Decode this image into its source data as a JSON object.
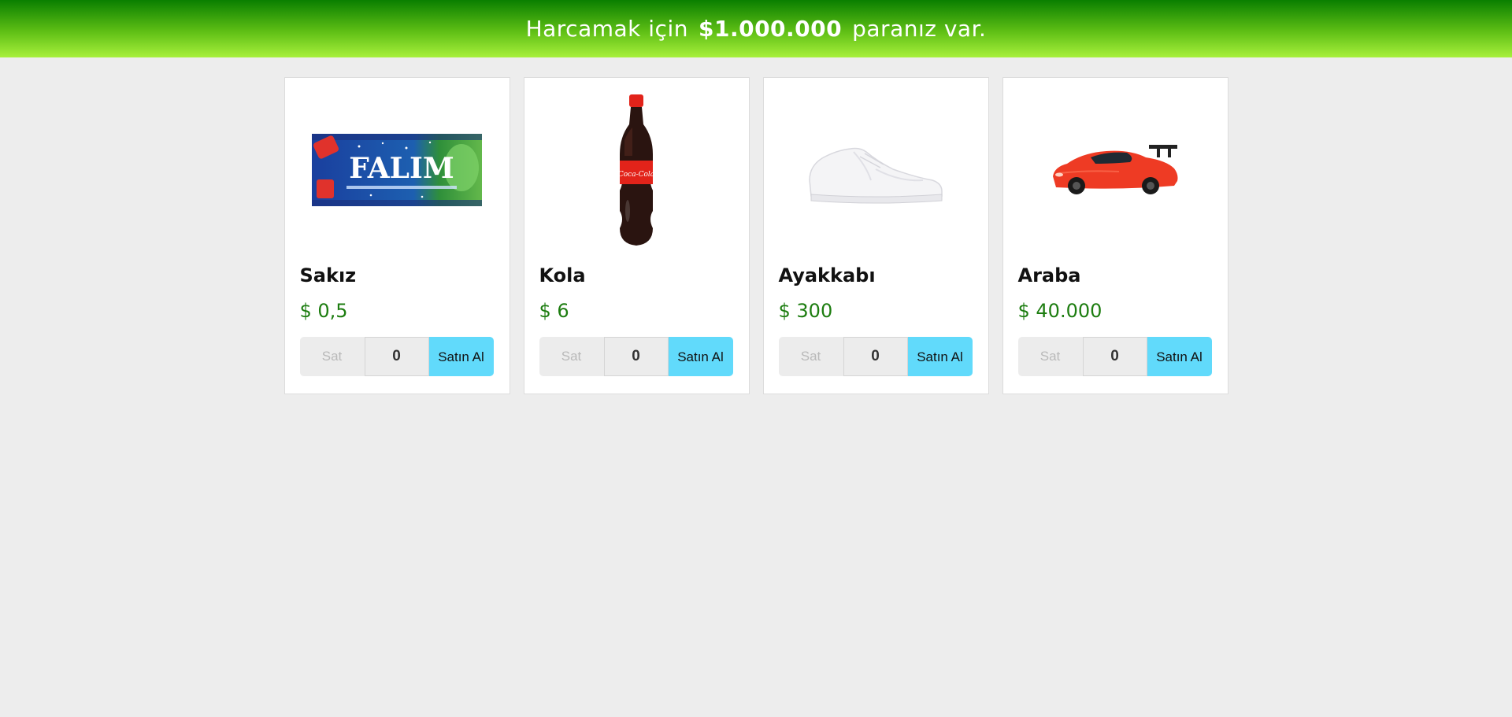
{
  "header": {
    "prefix": "Harcamak için",
    "money": "$1.000.000",
    "suffix": "paranız var."
  },
  "products": [
    {
      "name": "Sakız",
      "price": "$ 0,5",
      "sell_label": "Sat",
      "quantity": "0",
      "buy_label": "Satın Al",
      "image_icon": "gum-pack-image",
      "brand_text": "FALIM"
    },
    {
      "name": "Kola",
      "price": "$ 6",
      "sell_label": "Sat",
      "quantity": "0",
      "buy_label": "Satın Al",
      "image_icon": "cola-bottle-image",
      "brand_text": "Coca-Cola"
    },
    {
      "name": "Ayakkabı",
      "price": "$ 300",
      "sell_label": "Sat",
      "quantity": "0",
      "buy_label": "Satın Al",
      "image_icon": "sneaker-image"
    },
    {
      "name": "Araba",
      "price": "$ 40.000",
      "sell_label": "Sat",
      "quantity": "0",
      "buy_label": "Satın Al",
      "image_icon": "red-sports-car-image"
    }
  ],
  "colors": {
    "header_gradient_top": "#0a7f00",
    "header_gradient_bottom": "#a8f03c",
    "price": "#1d7d10",
    "buy_button": "#61dafb",
    "page_background": "#ededed"
  }
}
